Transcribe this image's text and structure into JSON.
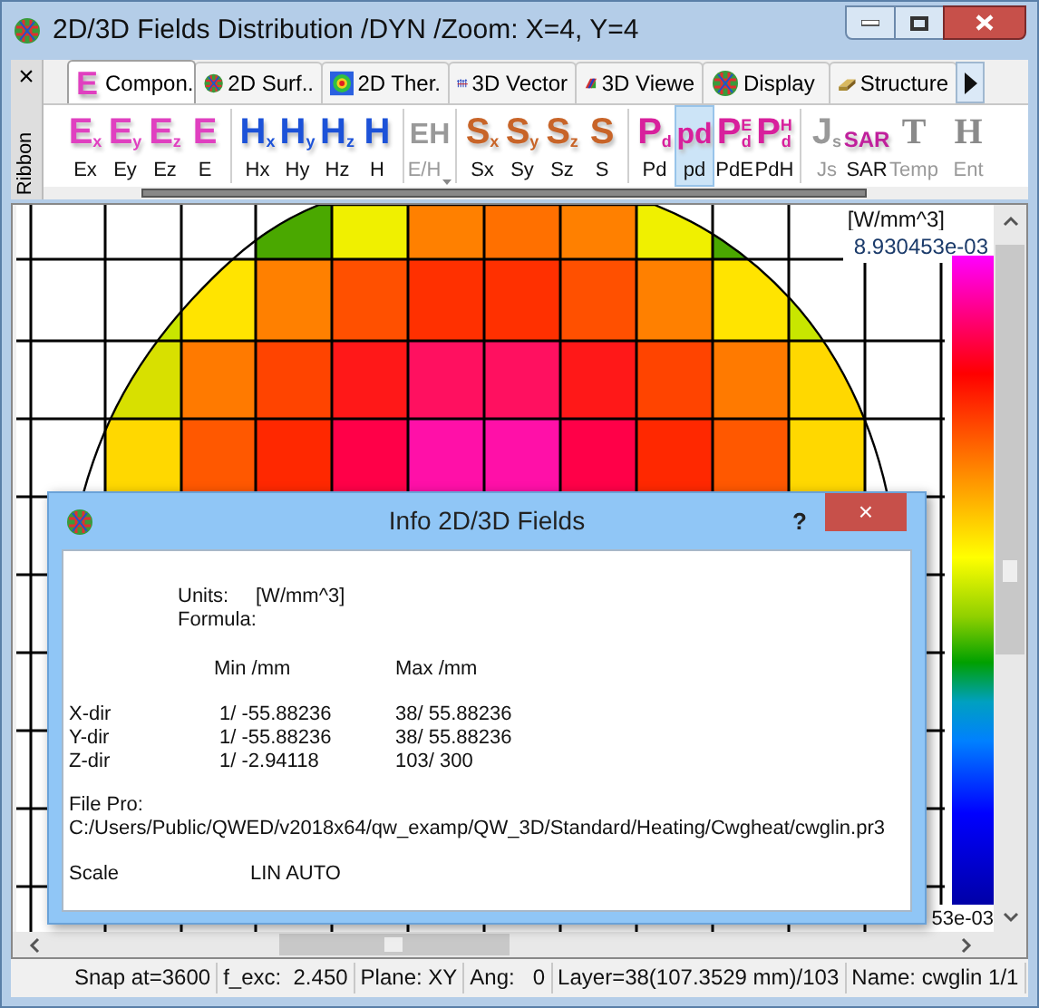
{
  "window": {
    "title": "2D/3D Fields Distribution /DYN /Zoom: X=4, Y=4"
  },
  "ribbon": {
    "label": "Ribbon",
    "close": "×"
  },
  "tabs": [
    {
      "label": "Compon.",
      "selected": true,
      "kind": "letter",
      "glyph": "E"
    },
    {
      "label": "2D Surf..",
      "selected": false,
      "kind": "mesh"
    },
    {
      "label": "2D Ther.",
      "selected": false,
      "kind": "thermal"
    },
    {
      "label": "3D Vector",
      "selected": false,
      "kind": "vector"
    },
    {
      "label": "3D Viewe",
      "selected": false,
      "kind": "viewer"
    },
    {
      "label": "Display",
      "selected": false,
      "kind": "mesh"
    },
    {
      "label": "Structure",
      "selected": false,
      "kind": "structure"
    }
  ],
  "buttons": [
    {
      "kind": "e",
      "main": "E",
      "sub": "x",
      "label": "Ex",
      "selected": false,
      "disabled": false
    },
    {
      "kind": "e",
      "main": "E",
      "sub": "y",
      "label": "Ey",
      "selected": false,
      "disabled": false
    },
    {
      "kind": "e",
      "main": "E",
      "sub": "z",
      "label": "Ez",
      "selected": false,
      "disabled": false
    },
    {
      "kind": "e",
      "main": "E",
      "label": "E",
      "selected": false,
      "disabled": false,
      "group_end": true
    },
    {
      "kind": "h",
      "main": "H",
      "sub": "x",
      "label": "Hx",
      "selected": false,
      "disabled": false
    },
    {
      "kind": "h",
      "main": "H",
      "sub": "y",
      "label": "Hy",
      "selected": false,
      "disabled": false
    },
    {
      "kind": "h",
      "main": "H",
      "sub": "z",
      "label": "Hz",
      "selected": false,
      "disabled": false
    },
    {
      "kind": "h",
      "main": "H",
      "label": "H",
      "selected": false,
      "disabled": false,
      "group_end": true
    },
    {
      "kind": "eh",
      "main": "EH",
      "label": "E/H",
      "selected": false,
      "disabled": true,
      "dropdown": true,
      "group_end": true
    },
    {
      "kind": "s",
      "main": "S",
      "sub": "x",
      "label": "Sx",
      "selected": false,
      "disabled": false
    },
    {
      "kind": "s",
      "main": "S",
      "sub": "y",
      "label": "Sy",
      "selected": false,
      "disabled": false
    },
    {
      "kind": "s",
      "main": "S",
      "sub": "z",
      "label": "Sz",
      "selected": false,
      "disabled": false
    },
    {
      "kind": "s",
      "main": "S",
      "label": "S",
      "selected": false,
      "disabled": false,
      "group_end": true
    },
    {
      "kind": "p",
      "main": "P",
      "sub": "d",
      "label": "Pd",
      "selected": false,
      "disabled": false
    },
    {
      "kind": "p",
      "main": "pd",
      "label": "pd",
      "selected": true,
      "disabled": false
    },
    {
      "kind": "p",
      "main": "P",
      "sub": "d",
      "sup": "E",
      "label": "PdE",
      "selected": false,
      "disabled": false
    },
    {
      "kind": "p",
      "main": "P",
      "sub": "d",
      "sup": "H",
      "label": "PdH",
      "selected": false,
      "disabled": false,
      "group_end": true
    },
    {
      "kind": "j",
      "main": "J",
      "sub": "s",
      "label": "Js",
      "selected": false,
      "disabled": true
    },
    {
      "kind": "sar",
      "main": "SAR",
      "label": "SAR",
      "selected": false,
      "disabled": false
    },
    {
      "kind": "t",
      "main": "T",
      "label": "Temp",
      "selected": false,
      "disabled": true
    },
    {
      "kind": "t",
      "main": "H",
      "label": "Ent",
      "selected": false,
      "disabled": true
    }
  ],
  "legend": {
    "unit": "[W/mm^3]",
    "max": "8.930453e-03",
    "min": "53e-03"
  },
  "dialog": {
    "title": "Info 2D/3D Fields",
    "help": "?",
    "close": "×",
    "units_label": "Units:",
    "units_value": "[W/mm^3]",
    "formula_label": "Formula:",
    "min_header": "Min /mm",
    "max_header": "Max /mm",
    "rows": [
      {
        "label": "X-dir",
        "min": "1/ -55.88236",
        "max": "38/ 55.88236"
      },
      {
        "label": "Y-dir",
        "min": "1/ -55.88236",
        "max": "38/ 55.88236"
      },
      {
        "label": "Z-dir",
        "min": "1/ -2.94118",
        "max": "103/ 300"
      }
    ],
    "file_label": "File Pro:",
    "file_path": "C:/Users/Public/QWED/v2018x64/qw_examp/QW_3D/Standard/Heating/Cwgheat/cwglin.pr3",
    "scale_label": "Scale",
    "scale_value": "LIN AUTO"
  },
  "status_bar": [
    "Snap at=3600",
    "f_exc:  2.450",
    "Plane: XY",
    "Ang:   0",
    "Layer=38(107.3529 mm)/103",
    "Name: cwglin 1/1"
  ]
}
